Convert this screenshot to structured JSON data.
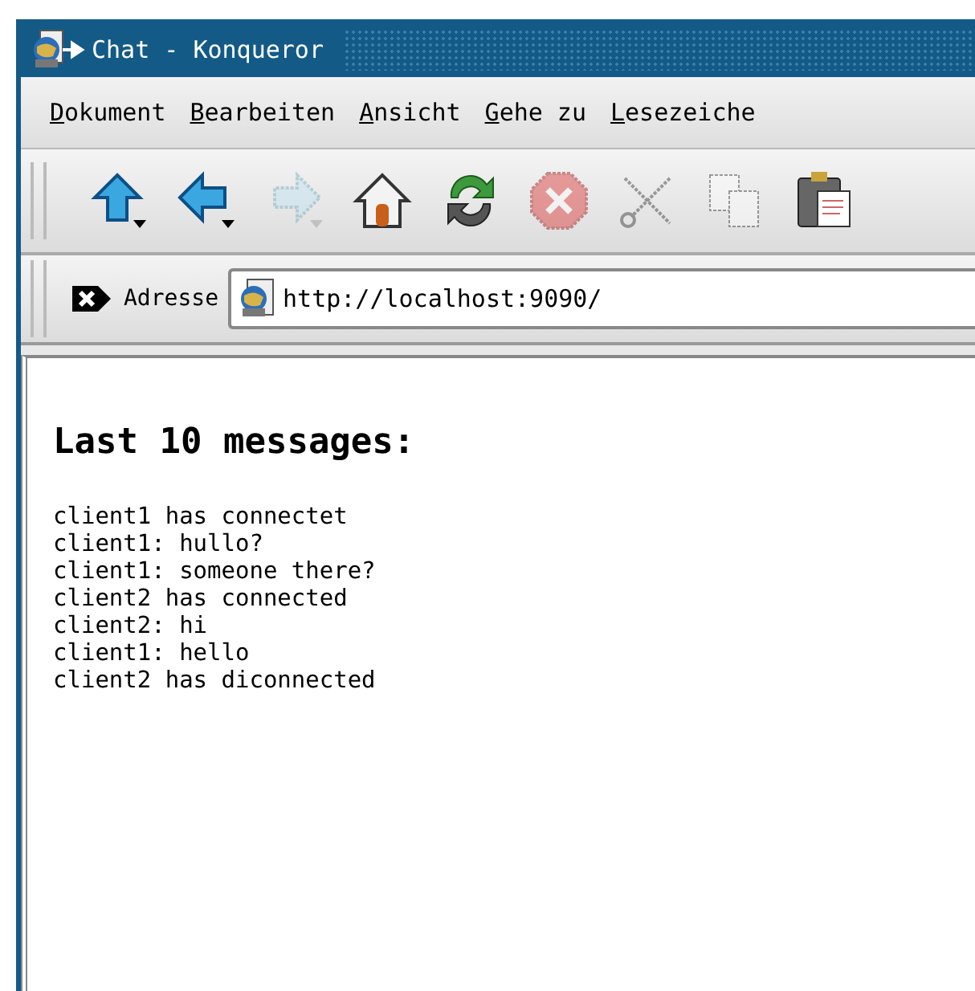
{
  "window": {
    "title": "Chat - Konqueror"
  },
  "menu": [
    "Dokument",
    "Bearbeiten",
    "Ansicht",
    "Gehe zu",
    "Lesezeiche"
  ],
  "toolbar": [
    {
      "kind": "up",
      "disabled": false
    },
    {
      "kind": "back",
      "disabled": false
    },
    {
      "kind": "forward",
      "disabled": true
    },
    {
      "kind": "home",
      "disabled": false
    },
    {
      "kind": "reload",
      "disabled": false
    },
    {
      "kind": "stop",
      "disabled": true
    },
    {
      "kind": "cut",
      "disabled": true
    },
    {
      "kind": "copy",
      "disabled": true
    },
    {
      "kind": "paste",
      "disabled": false
    }
  ],
  "location": {
    "label": "Adresse",
    "value": "http://localhost:9090/"
  },
  "page": {
    "heading": "Last 10 messages:",
    "messages": [
      "client1 has connectet",
      "client1: hullo?",
      "client1: someone there?",
      "client2 has connected",
      "client2: hi",
      "client1: hello",
      "client2 has diconnected"
    ]
  }
}
